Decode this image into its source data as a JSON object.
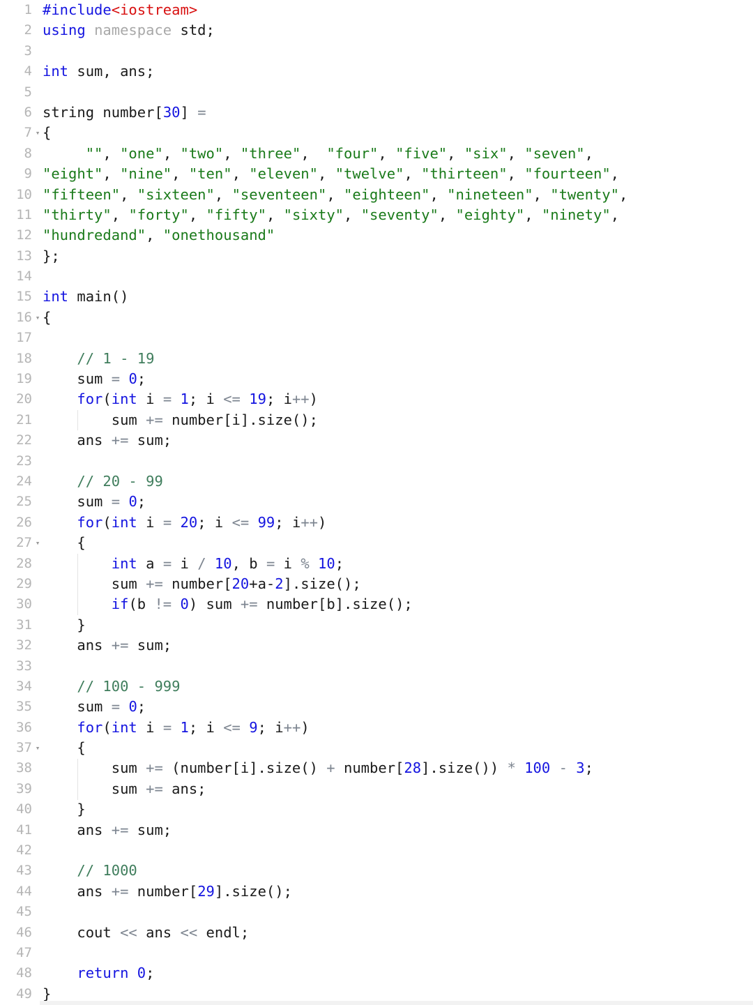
{
  "editor": {
    "language": "C++",
    "background": "#ffffff",
    "gutter_color": "#b5b5b5",
    "total_lines": 49,
    "colors": {
      "keyword": "#1414e0",
      "number": "#1414e0",
      "string": "#1a7a1a",
      "comment": "#3f7d5c",
      "include_path": "#d81010",
      "operator": "#7d8590",
      "namespace": "#a8a8a8",
      "plain": "#1a1a1a"
    },
    "fold_marker": "▾",
    "fold_lines": [
      7,
      16,
      27,
      37
    ]
  },
  "lines": [
    {
      "n": "1",
      "fold": false,
      "tokens": [
        {
          "t": "#include",
          "c": "kw"
        },
        {
          "t": "<iostream>",
          "c": "inc"
        }
      ]
    },
    {
      "n": "2",
      "fold": false,
      "tokens": [
        {
          "t": "using",
          "c": "kw"
        },
        {
          "t": " ",
          "c": "pl"
        },
        {
          "t": "namespace",
          "c": "ns"
        },
        {
          "t": " std;",
          "c": "pl"
        }
      ]
    },
    {
      "n": "3",
      "fold": false,
      "tokens": []
    },
    {
      "n": "4",
      "fold": false,
      "tokens": [
        {
          "t": "int",
          "c": "kw"
        },
        {
          "t": " sum, ans;",
          "c": "pl"
        }
      ]
    },
    {
      "n": "5",
      "fold": false,
      "tokens": []
    },
    {
      "n": "6",
      "fold": false,
      "tokens": [
        {
          "t": "string",
          "c": "pl"
        },
        {
          "t": " number[",
          "c": "pl"
        },
        {
          "t": "30",
          "c": "num"
        },
        {
          "t": "] ",
          "c": "pl"
        },
        {
          "t": "=",
          "c": "op"
        }
      ]
    },
    {
      "n": "7",
      "fold": true,
      "tokens": [
        {
          "t": "{",
          "c": "pl"
        }
      ]
    },
    {
      "n": "8",
      "fold": false,
      "tokens": [
        {
          "t": "     ",
          "c": "pl"
        },
        {
          "t": "\"\"",
          "c": "str"
        },
        {
          "t": ", ",
          "c": "pl"
        },
        {
          "t": "\"one\"",
          "c": "str"
        },
        {
          "t": ", ",
          "c": "pl"
        },
        {
          "t": "\"two\"",
          "c": "str"
        },
        {
          "t": ", ",
          "c": "pl"
        },
        {
          "t": "\"three\"",
          "c": "str"
        },
        {
          "t": ",  ",
          "c": "pl"
        },
        {
          "t": "\"four\"",
          "c": "str"
        },
        {
          "t": ", ",
          "c": "pl"
        },
        {
          "t": "\"five\"",
          "c": "str"
        },
        {
          "t": ", ",
          "c": "pl"
        },
        {
          "t": "\"six\"",
          "c": "str"
        },
        {
          "t": ", ",
          "c": "pl"
        },
        {
          "t": "\"seven\"",
          "c": "str"
        },
        {
          "t": ",",
          "c": "pl"
        }
      ]
    },
    {
      "n": "9",
      "fold": false,
      "tokens": [
        {
          "t": "\"eight\"",
          "c": "str"
        },
        {
          "t": ", ",
          "c": "pl"
        },
        {
          "t": "\"nine\"",
          "c": "str"
        },
        {
          "t": ", ",
          "c": "pl"
        },
        {
          "t": "\"ten\"",
          "c": "str"
        },
        {
          "t": ", ",
          "c": "pl"
        },
        {
          "t": "\"eleven\"",
          "c": "str"
        },
        {
          "t": ", ",
          "c": "pl"
        },
        {
          "t": "\"twelve\"",
          "c": "str"
        },
        {
          "t": ", ",
          "c": "pl"
        },
        {
          "t": "\"thirteen\"",
          "c": "str"
        },
        {
          "t": ", ",
          "c": "pl"
        },
        {
          "t": "\"fourteen\"",
          "c": "str"
        },
        {
          "t": ",",
          "c": "pl"
        }
      ]
    },
    {
      "n": "10",
      "fold": false,
      "tokens": [
        {
          "t": "\"fifteen\"",
          "c": "str"
        },
        {
          "t": ", ",
          "c": "pl"
        },
        {
          "t": "\"sixteen\"",
          "c": "str"
        },
        {
          "t": ", ",
          "c": "pl"
        },
        {
          "t": "\"seventeen\"",
          "c": "str"
        },
        {
          "t": ", ",
          "c": "pl"
        },
        {
          "t": "\"eighteen\"",
          "c": "str"
        },
        {
          "t": ", ",
          "c": "pl"
        },
        {
          "t": "\"nineteen\"",
          "c": "str"
        },
        {
          "t": ", ",
          "c": "pl"
        },
        {
          "t": "\"twenty\"",
          "c": "str"
        },
        {
          "t": ",",
          "c": "pl"
        }
      ]
    },
    {
      "n": "11",
      "fold": false,
      "tokens": [
        {
          "t": "\"thirty\"",
          "c": "str"
        },
        {
          "t": ", ",
          "c": "pl"
        },
        {
          "t": "\"forty\"",
          "c": "str"
        },
        {
          "t": ", ",
          "c": "pl"
        },
        {
          "t": "\"fifty\"",
          "c": "str"
        },
        {
          "t": ", ",
          "c": "pl"
        },
        {
          "t": "\"sixty\"",
          "c": "str"
        },
        {
          "t": ", ",
          "c": "pl"
        },
        {
          "t": "\"seventy\"",
          "c": "str"
        },
        {
          "t": ", ",
          "c": "pl"
        },
        {
          "t": "\"eighty\"",
          "c": "str"
        },
        {
          "t": ", ",
          "c": "pl"
        },
        {
          "t": "\"ninety\"",
          "c": "str"
        },
        {
          "t": ",",
          "c": "pl"
        }
      ]
    },
    {
      "n": "12",
      "fold": false,
      "tokens": [
        {
          "t": "\"hundredand\"",
          "c": "str"
        },
        {
          "t": ", ",
          "c": "pl"
        },
        {
          "t": "\"onethousand\"",
          "c": "str"
        }
      ]
    },
    {
      "n": "13",
      "fold": false,
      "tokens": [
        {
          "t": "};",
          "c": "pl"
        }
      ]
    },
    {
      "n": "14",
      "fold": false,
      "tokens": []
    },
    {
      "n": "15",
      "fold": false,
      "tokens": [
        {
          "t": "int",
          "c": "kw"
        },
        {
          "t": " main()",
          "c": "pl"
        }
      ]
    },
    {
      "n": "16",
      "fold": true,
      "tokens": [
        {
          "t": "{",
          "c": "pl"
        }
      ]
    },
    {
      "n": "17",
      "fold": false,
      "tokens": []
    },
    {
      "n": "18",
      "fold": false,
      "tokens": [
        {
          "t": "    ",
          "c": "pl"
        },
        {
          "t": "// 1 - 19",
          "c": "cmt"
        }
      ]
    },
    {
      "n": "19",
      "fold": false,
      "tokens": [
        {
          "t": "    sum ",
          "c": "pl"
        },
        {
          "t": "=",
          "c": "op"
        },
        {
          "t": " ",
          "c": "pl"
        },
        {
          "t": "0",
          "c": "num"
        },
        {
          "t": ";",
          "c": "pl"
        }
      ]
    },
    {
      "n": "20",
      "fold": false,
      "tokens": [
        {
          "t": "    ",
          "c": "pl"
        },
        {
          "t": "for",
          "c": "kw"
        },
        {
          "t": "(",
          "c": "pl"
        },
        {
          "t": "int",
          "c": "kw"
        },
        {
          "t": " i ",
          "c": "pl"
        },
        {
          "t": "=",
          "c": "op"
        },
        {
          "t": " ",
          "c": "pl"
        },
        {
          "t": "1",
          "c": "num"
        },
        {
          "t": "; i ",
          "c": "pl"
        },
        {
          "t": "<=",
          "c": "op"
        },
        {
          "t": " ",
          "c": "pl"
        },
        {
          "t": "19",
          "c": "num"
        },
        {
          "t": "; i",
          "c": "pl"
        },
        {
          "t": "++",
          "c": "op"
        },
        {
          "t": ")",
          "c": "pl"
        }
      ]
    },
    {
      "n": "21",
      "fold": false,
      "tokens": [
        {
          "t": "        sum ",
          "c": "pl"
        },
        {
          "t": "+=",
          "c": "op"
        },
        {
          "t": " number[i].size();",
          "c": "pl"
        }
      ]
    },
    {
      "n": "22",
      "fold": false,
      "tokens": [
        {
          "t": "    ans ",
          "c": "pl"
        },
        {
          "t": "+=",
          "c": "op"
        },
        {
          "t": " sum;",
          "c": "pl"
        }
      ]
    },
    {
      "n": "23",
      "fold": false,
      "tokens": []
    },
    {
      "n": "24",
      "fold": false,
      "tokens": [
        {
          "t": "    ",
          "c": "pl"
        },
        {
          "t": "// 20 - 99",
          "c": "cmt"
        }
      ]
    },
    {
      "n": "25",
      "fold": false,
      "tokens": [
        {
          "t": "    sum ",
          "c": "pl"
        },
        {
          "t": "=",
          "c": "op"
        },
        {
          "t": " ",
          "c": "pl"
        },
        {
          "t": "0",
          "c": "num"
        },
        {
          "t": ";",
          "c": "pl"
        }
      ]
    },
    {
      "n": "26",
      "fold": false,
      "tokens": [
        {
          "t": "    ",
          "c": "pl"
        },
        {
          "t": "for",
          "c": "kw"
        },
        {
          "t": "(",
          "c": "pl"
        },
        {
          "t": "int",
          "c": "kw"
        },
        {
          "t": " i ",
          "c": "pl"
        },
        {
          "t": "=",
          "c": "op"
        },
        {
          "t": " ",
          "c": "pl"
        },
        {
          "t": "20",
          "c": "num"
        },
        {
          "t": "; i ",
          "c": "pl"
        },
        {
          "t": "<=",
          "c": "op"
        },
        {
          "t": " ",
          "c": "pl"
        },
        {
          "t": "99",
          "c": "num"
        },
        {
          "t": "; i",
          "c": "pl"
        },
        {
          "t": "++",
          "c": "op"
        },
        {
          "t": ")",
          "c": "pl"
        }
      ]
    },
    {
      "n": "27",
      "fold": true,
      "tokens": [
        {
          "t": "    {",
          "c": "pl"
        }
      ]
    },
    {
      "n": "28",
      "fold": false,
      "tokens": [
        {
          "t": "        ",
          "c": "pl"
        },
        {
          "t": "int",
          "c": "kw"
        },
        {
          "t": " a ",
          "c": "pl"
        },
        {
          "t": "=",
          "c": "op"
        },
        {
          "t": " i ",
          "c": "pl"
        },
        {
          "t": "/",
          "c": "op"
        },
        {
          "t": " ",
          "c": "pl"
        },
        {
          "t": "10",
          "c": "num"
        },
        {
          "t": ", b ",
          "c": "pl"
        },
        {
          "t": "=",
          "c": "op"
        },
        {
          "t": " i ",
          "c": "pl"
        },
        {
          "t": "%",
          "c": "op"
        },
        {
          "t": " ",
          "c": "pl"
        },
        {
          "t": "10",
          "c": "num"
        },
        {
          "t": ";",
          "c": "pl"
        }
      ]
    },
    {
      "n": "29",
      "fold": false,
      "tokens": [
        {
          "t": "        sum ",
          "c": "pl"
        },
        {
          "t": "+=",
          "c": "op"
        },
        {
          "t": " number[",
          "c": "pl"
        },
        {
          "t": "20",
          "c": "num"
        },
        {
          "t": "+a-",
          "c": "pl"
        },
        {
          "t": "2",
          "c": "num"
        },
        {
          "t": "].size();",
          "c": "pl"
        }
      ]
    },
    {
      "n": "30",
      "fold": false,
      "tokens": [
        {
          "t": "        ",
          "c": "pl"
        },
        {
          "t": "if",
          "c": "kw"
        },
        {
          "t": "(b ",
          "c": "pl"
        },
        {
          "t": "!=",
          "c": "op"
        },
        {
          "t": " ",
          "c": "pl"
        },
        {
          "t": "0",
          "c": "num"
        },
        {
          "t": ") sum ",
          "c": "pl"
        },
        {
          "t": "+=",
          "c": "op"
        },
        {
          "t": " number[b].size();",
          "c": "pl"
        }
      ]
    },
    {
      "n": "31",
      "fold": false,
      "tokens": [
        {
          "t": "    }",
          "c": "pl"
        }
      ]
    },
    {
      "n": "32",
      "fold": false,
      "tokens": [
        {
          "t": "    ans ",
          "c": "pl"
        },
        {
          "t": "+=",
          "c": "op"
        },
        {
          "t": " sum;",
          "c": "pl"
        }
      ]
    },
    {
      "n": "33",
      "fold": false,
      "tokens": []
    },
    {
      "n": "34",
      "fold": false,
      "tokens": [
        {
          "t": "    ",
          "c": "pl"
        },
        {
          "t": "// 100 - 999",
          "c": "cmt"
        }
      ]
    },
    {
      "n": "35",
      "fold": false,
      "tokens": [
        {
          "t": "    sum ",
          "c": "pl"
        },
        {
          "t": "=",
          "c": "op"
        },
        {
          "t": " ",
          "c": "pl"
        },
        {
          "t": "0",
          "c": "num"
        },
        {
          "t": ";",
          "c": "pl"
        }
      ]
    },
    {
      "n": "36",
      "fold": false,
      "tokens": [
        {
          "t": "    ",
          "c": "pl"
        },
        {
          "t": "for",
          "c": "kw"
        },
        {
          "t": "(",
          "c": "pl"
        },
        {
          "t": "int",
          "c": "kw"
        },
        {
          "t": " i ",
          "c": "pl"
        },
        {
          "t": "=",
          "c": "op"
        },
        {
          "t": " ",
          "c": "pl"
        },
        {
          "t": "1",
          "c": "num"
        },
        {
          "t": "; i ",
          "c": "pl"
        },
        {
          "t": "<=",
          "c": "op"
        },
        {
          "t": " ",
          "c": "pl"
        },
        {
          "t": "9",
          "c": "num"
        },
        {
          "t": "; i",
          "c": "pl"
        },
        {
          "t": "++",
          "c": "op"
        },
        {
          "t": ")",
          "c": "pl"
        }
      ]
    },
    {
      "n": "37",
      "fold": true,
      "tokens": [
        {
          "t": "    {",
          "c": "pl"
        }
      ]
    },
    {
      "n": "38",
      "fold": false,
      "tokens": [
        {
          "t": "        sum ",
          "c": "pl"
        },
        {
          "t": "+=",
          "c": "op"
        },
        {
          "t": " (number[i].size() ",
          "c": "pl"
        },
        {
          "t": "+",
          "c": "op"
        },
        {
          "t": " number[",
          "c": "pl"
        },
        {
          "t": "28",
          "c": "num"
        },
        {
          "t": "].size()) ",
          "c": "pl"
        },
        {
          "t": "*",
          "c": "op"
        },
        {
          "t": " ",
          "c": "pl"
        },
        {
          "t": "100",
          "c": "num"
        },
        {
          "t": " ",
          "c": "pl"
        },
        {
          "t": "-",
          "c": "op"
        },
        {
          "t": " ",
          "c": "pl"
        },
        {
          "t": "3",
          "c": "num"
        },
        {
          "t": ";",
          "c": "pl"
        }
      ]
    },
    {
      "n": "39",
      "fold": false,
      "tokens": [
        {
          "t": "        sum ",
          "c": "pl"
        },
        {
          "t": "+=",
          "c": "op"
        },
        {
          "t": " ans;",
          "c": "pl"
        }
      ]
    },
    {
      "n": "40",
      "fold": false,
      "tokens": [
        {
          "t": "    }",
          "c": "pl"
        }
      ]
    },
    {
      "n": "41",
      "fold": false,
      "tokens": [
        {
          "t": "    ans ",
          "c": "pl"
        },
        {
          "t": "+=",
          "c": "op"
        },
        {
          "t": " sum;",
          "c": "pl"
        }
      ]
    },
    {
      "n": "42",
      "fold": false,
      "tokens": []
    },
    {
      "n": "43",
      "fold": false,
      "tokens": [
        {
          "t": "    ",
          "c": "pl"
        },
        {
          "t": "// 1000",
          "c": "cmt"
        }
      ]
    },
    {
      "n": "44",
      "fold": false,
      "tokens": [
        {
          "t": "    ans ",
          "c": "pl"
        },
        {
          "t": "+=",
          "c": "op"
        },
        {
          "t": " number[",
          "c": "pl"
        },
        {
          "t": "29",
          "c": "num"
        },
        {
          "t": "].size();",
          "c": "pl"
        }
      ]
    },
    {
      "n": "45",
      "fold": false,
      "tokens": []
    },
    {
      "n": "46",
      "fold": false,
      "tokens": [
        {
          "t": "    cout ",
          "c": "pl"
        },
        {
          "t": "<<",
          "c": "op"
        },
        {
          "t": " ans ",
          "c": "pl"
        },
        {
          "t": "<<",
          "c": "op"
        },
        {
          "t": " endl;",
          "c": "pl"
        }
      ]
    },
    {
      "n": "47",
      "fold": false,
      "tokens": []
    },
    {
      "n": "48",
      "fold": false,
      "tokens": [
        {
          "t": "    ",
          "c": "pl"
        },
        {
          "t": "return",
          "c": "kw"
        },
        {
          "t": " ",
          "c": "pl"
        },
        {
          "t": "0",
          "c": "num"
        },
        {
          "t": ";",
          "c": "pl"
        }
      ]
    },
    {
      "n": "49",
      "fold": false,
      "tokens": [
        {
          "t": "}",
          "c": "pl"
        }
      ]
    }
  ]
}
